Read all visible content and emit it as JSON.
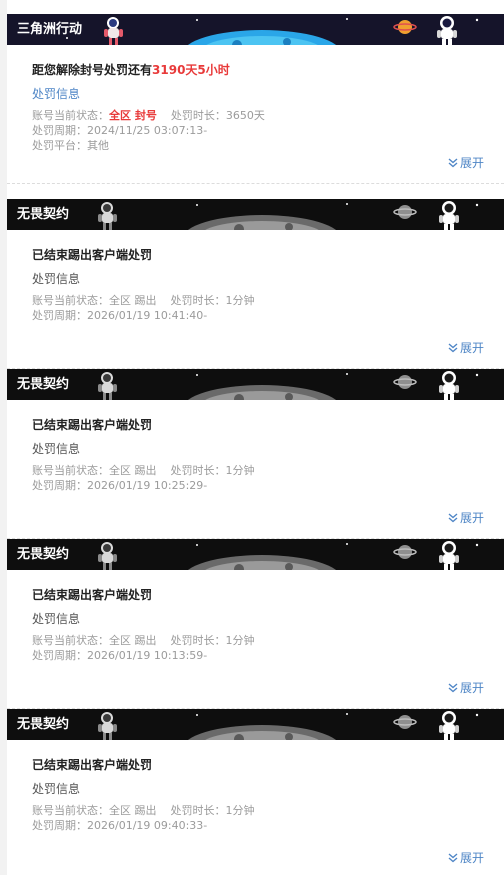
{
  "records": [
    {
      "banner_title": "三角洲行动",
      "headline_prefix": "距您解除封号处罚还有",
      "headline_highlight": "3190天5小时",
      "headline": "",
      "info_label": "处罚信息",
      "status_label": "账号当前状态：",
      "status_value": "全区 封号",
      "duration_label": "处罚时长：",
      "duration_value": "3650天",
      "period_label": "处罚周期：",
      "period_value": "2024/11/25 03:07:13-",
      "platform_label": "处罚平台：",
      "platform_value": "其他",
      "expand_label": "展开"
    },
    {
      "banner_title": "无畏契约",
      "headline": "已结束踢出客户端处罚",
      "info_label": "处罚信息",
      "status_label": "账号当前状态：",
      "status_value": "全区 踢出",
      "duration_label": "处罚时长：",
      "duration_value": "1分钟",
      "period_label": "处罚周期：",
      "period_value": "2026/01/19 10:41:40-",
      "expand_label": "展开"
    },
    {
      "banner_title": "无畏契约",
      "headline": "已结束踢出客户端处罚",
      "info_label": "处罚信息",
      "status_label": "账号当前状态：",
      "status_value": "全区 踢出",
      "duration_label": "处罚时长：",
      "duration_value": "1分钟",
      "period_label": "处罚周期：",
      "period_value": "2026/01/19 10:25:29-",
      "expand_label": "展开"
    },
    {
      "banner_title": "无畏契约",
      "headline": "已结束踢出客户端处罚",
      "info_label": "处罚信息",
      "status_label": "账号当前状态：",
      "status_value": "全区 踢出",
      "duration_label": "处罚时长：",
      "duration_value": "1分钟",
      "period_label": "处罚周期：",
      "period_value": "2026/01/19 10:13:59-",
      "expand_label": "展开"
    },
    {
      "banner_title": "无畏契约",
      "headline": "已结束踢出客户端处罚",
      "info_label": "处罚信息",
      "status_label": "账号当前状态：",
      "status_value": "全区 踢出",
      "duration_label": "处罚时长：",
      "duration_value": "1分钟",
      "period_label": "处罚周期：",
      "period_value": "2026/01/19 09:40:33-",
      "expand_label": "展开"
    }
  ],
  "colors": {
    "accent_blue": "#4f86c6",
    "highlight_red": "#e83a3a",
    "delta_banner": "#15142a",
    "valorant_banner": "#0e0e0e"
  },
  "icons": {
    "expand": "double-chevron-down-icon",
    "banner_art": "astronaut-planet-illustration"
  }
}
